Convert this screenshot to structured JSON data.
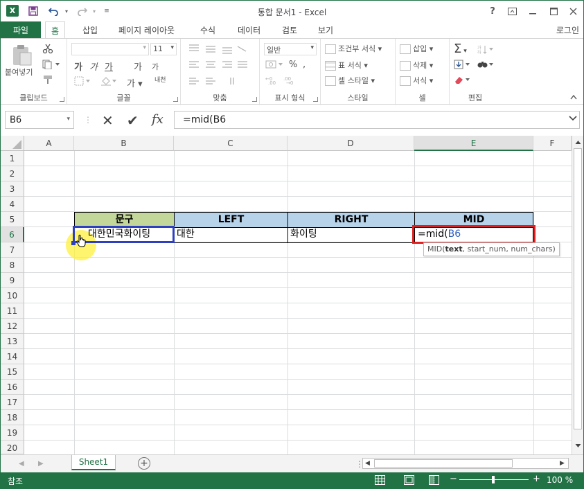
{
  "app": {
    "title": "통합 문서1 - Excel",
    "logo_letter": "X",
    "accent_color": "#217346"
  },
  "quick_access": {
    "icons": [
      "save-icon",
      "undo-icon",
      "redo-icon",
      "customize-icon"
    ]
  },
  "window_controls": {
    "help": "?",
    "ribbon_display": "⊡",
    "minimize": "—",
    "maximize": "☐",
    "close": "✕"
  },
  "tabs": [
    {
      "label": "파일"
    },
    {
      "label": "홈"
    },
    {
      "label": "삽입"
    },
    {
      "label": "페이지 레이아웃"
    },
    {
      "label": "수식"
    },
    {
      "label": "데이터"
    },
    {
      "label": "검토"
    },
    {
      "label": "보기"
    }
  ],
  "account": {
    "signin": "로그인"
  },
  "ribbon": {
    "clipboard": {
      "label": "클립보드",
      "paste": "붙여넣기"
    },
    "font": {
      "label": "글꼴",
      "size": "11",
      "bold": "가",
      "italic": "가",
      "underline": "가",
      "grow": "가",
      "shrink": "가",
      "phonetic": "내천"
    },
    "alignment": {
      "label": "맞춤"
    },
    "number": {
      "label": "표시 형식",
      "format": "일반",
      "percent": "%"
    },
    "styles": {
      "label": "스타일",
      "conditional": "조건부 서식",
      "table": "표 서식",
      "cell_styles": "셀 스타일"
    },
    "cells": {
      "label": "셀",
      "insert": "삽입",
      "delete": "삭제",
      "format": "서식"
    },
    "editing": {
      "label": "편집",
      "sum": "Σ"
    }
  },
  "formula_bar": {
    "name_box": "B6",
    "cancel": "✕",
    "enter": "✔",
    "fx": "fx",
    "formula": "=mid(B6"
  },
  "columns": [
    "A",
    "B",
    "C",
    "D",
    "E",
    "F"
  ],
  "rows": [
    "1",
    "2",
    "3",
    "4",
    "5",
    "6",
    "7",
    "8",
    "9",
    "10",
    "11",
    "12",
    "13",
    "14",
    "15",
    "16",
    "17",
    "18",
    "19",
    "20"
  ],
  "cells": {
    "B5": "문구",
    "C5": "LEFT",
    "D5": "RIGHT",
    "E5": "MID",
    "B6": "대한민국화이팅",
    "C6": "대한",
    "D6": "화이팅",
    "E6_prefix": "=mid(",
    "E6_ref": "B6"
  },
  "tooltip": {
    "fn": "MID(",
    "arg1": "text",
    "rest": ", start_num, num_chars)"
  },
  "sheets": [
    {
      "label": "Sheet1"
    }
  ],
  "status": {
    "mode": "참조",
    "zoom": "100 %"
  }
}
